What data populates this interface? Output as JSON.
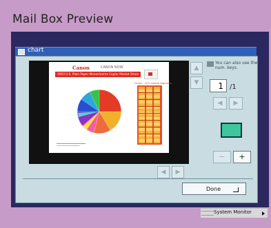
{
  "screen_title": "Mail Box Preview",
  "window": {
    "title": "chart"
  },
  "preview_document": {
    "brand": "Canon",
    "subtitle": "CANON NOW",
    "headline": "2003 U.S. Plain Paper Monochrome Copier Market Share",
    "table_heading": "Canon - 41% market segments"
  },
  "page": {
    "hint": "You can also use the num. keys.",
    "current": "1",
    "total": "/1"
  },
  "controls": {
    "done_label": "Done",
    "system_monitor_label": "System Monitor"
  },
  "colors": {
    "window_titlebar": "#2f5fb8",
    "dialog_bg": "#c8dce2",
    "preview_bg": "#111111",
    "status_swatch": "#3ec79f",
    "frame": "#c69bc7"
  }
}
